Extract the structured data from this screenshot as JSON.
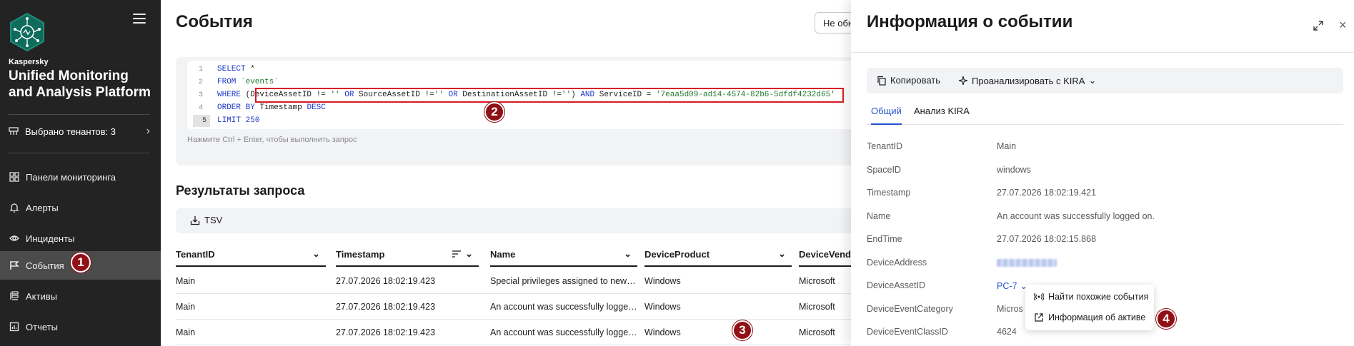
{
  "sidebar": {
    "brand_small": "Kaspersky",
    "brand_title": "Unified Monitoring and Analysis Platform",
    "tenants_label": "Выбрано тенантов: 3",
    "items": [
      {
        "label": "Панели мониторинга",
        "icon": "dashboard-icon"
      },
      {
        "label": "Алерты",
        "icon": "bell-icon"
      },
      {
        "label": "Инциденты",
        "icon": "eye-icon"
      },
      {
        "label": "События",
        "icon": "flag-icon"
      },
      {
        "label": "Активы",
        "icon": "assets-icon"
      },
      {
        "label": "Отчеты",
        "icon": "report-icon"
      }
    ],
    "active_item": "События"
  },
  "main": {
    "title": "События",
    "not_button": "Не обн",
    "query": {
      "line_numbers": [
        "1",
        "2",
        "3",
        "4",
        "5"
      ],
      "line1": {
        "kw": "SELECT",
        "rest": " *"
      },
      "line2": {
        "kw": "FROM",
        "str": " `events`"
      },
      "line3": {
        "kw1": "WHERE",
        "t1": " (DeviceAssetID != ",
        "s1": "''",
        "kw2": " OR",
        "t2": " SourceAssetID !=",
        "s2": "''",
        "kw3": " OR",
        "t3": " DestinationAssetID !=",
        "s3": "''",
        "t4": ")",
        "kw4": " AND",
        "t5": " ServiceID = ",
        "s4": "'7eaa5d09-ad14-4574-82b6-5dfdf4232d65'"
      },
      "line4": {
        "kw1": "ORDER",
        "kw2": " BY",
        "t": " Timestamp ",
        "kw3": "DESC"
      },
      "line5": {
        "kw": "LIMIT",
        "num": " 250"
      },
      "hint": "Нажмите Ctrl + Enter, чтобы выполнить запрос"
    },
    "results_title": "Результаты запроса",
    "tsv_label": "TSV",
    "columns": [
      "TenantID",
      "Timestamp",
      "Name",
      "DeviceProduct",
      "DeviceVendo"
    ],
    "rows": [
      [
        "Main",
        "27.07.2026 18:02:19.423",
        "Special privileges assigned to new …",
        "Windows",
        "Microsoft"
      ],
      [
        "Main",
        "27.07.2026 18:02:19.423",
        "An account was successfully logge…",
        "Windows",
        "Microsoft"
      ],
      [
        "Main",
        "27.07.2026 18:02:19.423",
        "An account was successfully logge…",
        "Windows",
        "Microsoft"
      ]
    ]
  },
  "panel": {
    "title": "Информация о событии",
    "copy_label": "Копировать",
    "kira_label": "Проанализировать с KIRA",
    "tabs": [
      "Общий",
      "Анализ KIRA"
    ],
    "fields": [
      {
        "key": "TenantID",
        "value": "Main"
      },
      {
        "key": "SpaceID",
        "value": "windows"
      },
      {
        "key": "Timestamp",
        "value": "27.07.2026 18:02:19.421"
      },
      {
        "key": "Name",
        "value": "An account was successfully logged on."
      },
      {
        "key": "EndTime",
        "value": "27.07.2026 18:02:15.868"
      },
      {
        "key": "DeviceAddress",
        "value": ""
      },
      {
        "key": "DeviceAssetID",
        "value": "PC-7"
      },
      {
        "key": "DeviceEventCategory",
        "value": "Micros"
      },
      {
        "key": "DeviceEventClassID",
        "value": "4624"
      }
    ]
  },
  "context_menu": {
    "items": [
      "Найти похожие события",
      "Информация об активе"
    ]
  },
  "badges": [
    "1",
    "2",
    "3",
    "4"
  ],
  "colors": {
    "sidebar_bg": "#232323",
    "active_bg": "#4b4b4b",
    "badge": "#8f1016",
    "highlight": "#d81b22",
    "link": "#2452cc",
    "keyword": "#1f39c7",
    "string": "#1f7a2a"
  }
}
